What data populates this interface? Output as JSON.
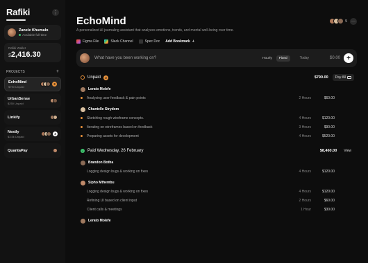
{
  "sidebar": {
    "brand": "Rafiki",
    "user": {
      "name": "Zanele Khumalo",
      "status": "Available full-time"
    },
    "wallet": {
      "label": "Rafiki Wallet",
      "currency": "$",
      "amount": "2,416.30"
    },
    "projects_header": "PROJECTS",
    "projects": [
      {
        "name": "EchoMind",
        "sub": "$790 Unpaid",
        "badge": "3",
        "badge_type": "orange"
      },
      {
        "name": "UrbanSense",
        "sub": "$250 Unpaid",
        "badge": "",
        "badge_type": ""
      },
      {
        "name": "Linkify",
        "sub": "",
        "badge": "",
        "badge_type": ""
      },
      {
        "name": "Nestly",
        "sub": "$3.5k Unpaid",
        "badge": "3",
        "badge_type": "white"
      },
      {
        "name": "QuantaPay",
        "sub": "",
        "badge": "",
        "badge_type": ""
      }
    ]
  },
  "main": {
    "title": "EchoMind",
    "subtitle": "A personalized AI journaling assistant that analyzes emotions, trends, and mental well-being over time.",
    "team_count": "5",
    "bookmarks": [
      "Figma File",
      "Slack Channel",
      "Spec Doc"
    ],
    "add_bookmark": "Add Bookmark",
    "composer": {
      "placeholder": "What have you been working on?",
      "mode_hourly": "Hourly",
      "mode_fixed": "Fixed",
      "date": "Today",
      "amount": "$0.00"
    },
    "unpaid": {
      "label": "Unpaid",
      "count": "3",
      "total": "$790.00",
      "pay_all": "Pay All",
      "groups": [
        {
          "person": "Lerato Molefe",
          "entries": [
            {
              "text": "Analysing user feedback & pain points",
              "hours": "2 Hours",
              "amount": "$60.00"
            }
          ]
        },
        {
          "person": "Chantelle Strydom",
          "entries": [
            {
              "text": "Sketching rough wireframe concepts.",
              "hours": "4 Hours",
              "amount": "$120.00"
            },
            {
              "text": "Iterating on wireframes based on feedback",
              "hours": "3 Hours",
              "amount": "$90.00"
            },
            {
              "text": "Preparing assets for development",
              "hours": "4 Hours",
              "amount": "$520.00"
            }
          ]
        }
      ]
    },
    "paid": {
      "label": "Paid Wednesday, 26 February",
      "total": "$8,460.00",
      "view": "View",
      "groups": [
        {
          "person": "Brandon Botha",
          "entries": [
            {
              "text": "Logging design bugs & working on fixes",
              "hours": "4 Hours",
              "amount": "$120.00"
            }
          ]
        },
        {
          "person": "Sipho Mthembu",
          "entries": [
            {
              "text": "Logging design bugs & working on fixes",
              "hours": "4 Hours",
              "amount": "$120.00"
            },
            {
              "text": "Refining UI based on client input",
              "hours": "2 Hours",
              "amount": "$60.00"
            },
            {
              "text": "Client calls & meetings",
              "hours": "1 Hour",
              "amount": "$30.00"
            }
          ]
        },
        {
          "person": "Lerato Molefe",
          "entries": []
        }
      ]
    }
  }
}
